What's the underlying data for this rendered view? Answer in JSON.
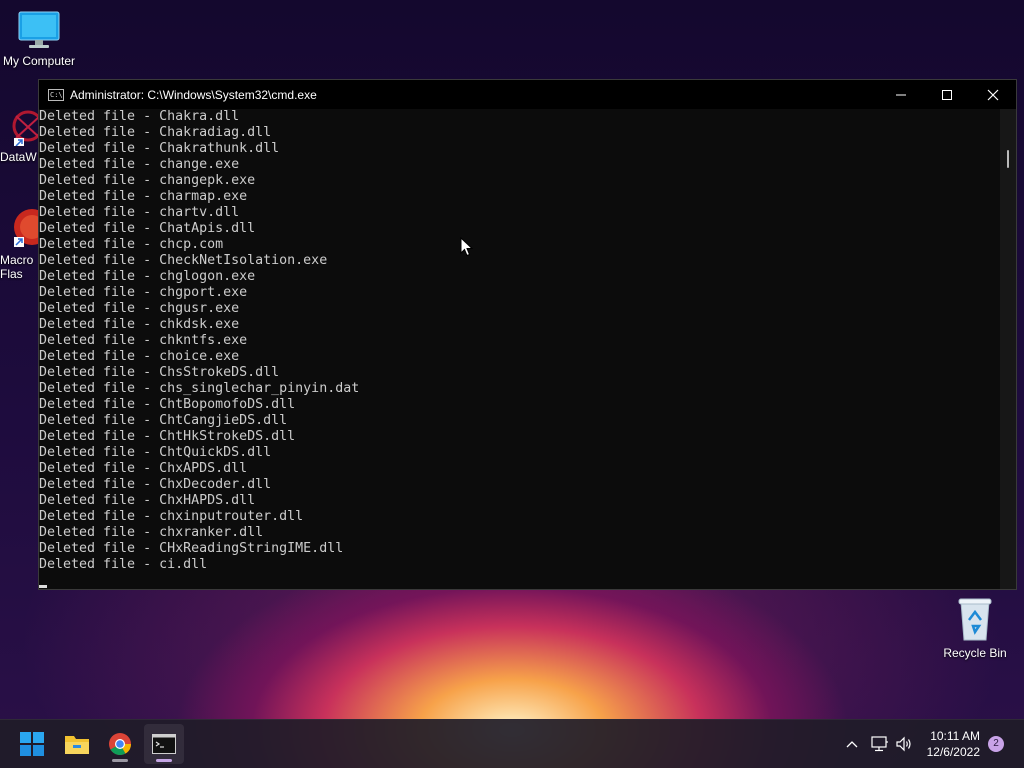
{
  "desktop": {
    "icons": [
      {
        "label": "My Computer"
      },
      {
        "label": "DataW"
      },
      {
        "label": "Macro\nFlas"
      },
      {
        "label": "Recycle Bin"
      }
    ]
  },
  "window": {
    "title": "Administrator:  C:\\Windows\\System32\\cmd.exe",
    "lines": [
      "Deleted file - Chakra.dll",
      "Deleted file - Chakradiag.dll",
      "Deleted file - Chakrathunk.dll",
      "Deleted file - change.exe",
      "Deleted file - changepk.exe",
      "Deleted file - charmap.exe",
      "Deleted file - chartv.dll",
      "Deleted file - ChatApis.dll",
      "Deleted file - chcp.com",
      "Deleted file - CheckNetIsolation.exe",
      "Deleted file - chglogon.exe",
      "Deleted file - chgport.exe",
      "Deleted file - chgusr.exe",
      "Deleted file - chkdsk.exe",
      "Deleted file - chkntfs.exe",
      "Deleted file - choice.exe",
      "Deleted file - ChsStrokeDS.dll",
      "Deleted file - chs_singlechar_pinyin.dat",
      "Deleted file - ChtBopomofoDS.dll",
      "Deleted file - ChtCangjieDS.dll",
      "Deleted file - ChtHkStrokeDS.dll",
      "Deleted file - ChtQuickDS.dll",
      "Deleted file - ChxAPDS.dll",
      "Deleted file - ChxDecoder.dll",
      "Deleted file - ChxHAPDS.dll",
      "Deleted file - chxinputrouter.dll",
      "Deleted file - chxranker.dll",
      "Deleted file - CHxReadingStringIME.dll",
      "Deleted file - ci.dll"
    ]
  },
  "taskbar": {
    "apps": [
      {
        "icon": "windows-start-icon"
      },
      {
        "icon": "file-explorer-icon"
      },
      {
        "icon": "chrome-icon"
      },
      {
        "icon": "command-prompt-icon"
      }
    ],
    "tray": {
      "time": "10:11 AM",
      "date": "12/6/2022",
      "notification_count": "2"
    }
  },
  "colors": {
    "console_bg": "#0c0c0c",
    "console_text": "#cccccc",
    "titlebar_bg": "#000000",
    "taskbar_bg": "#201c28"
  }
}
